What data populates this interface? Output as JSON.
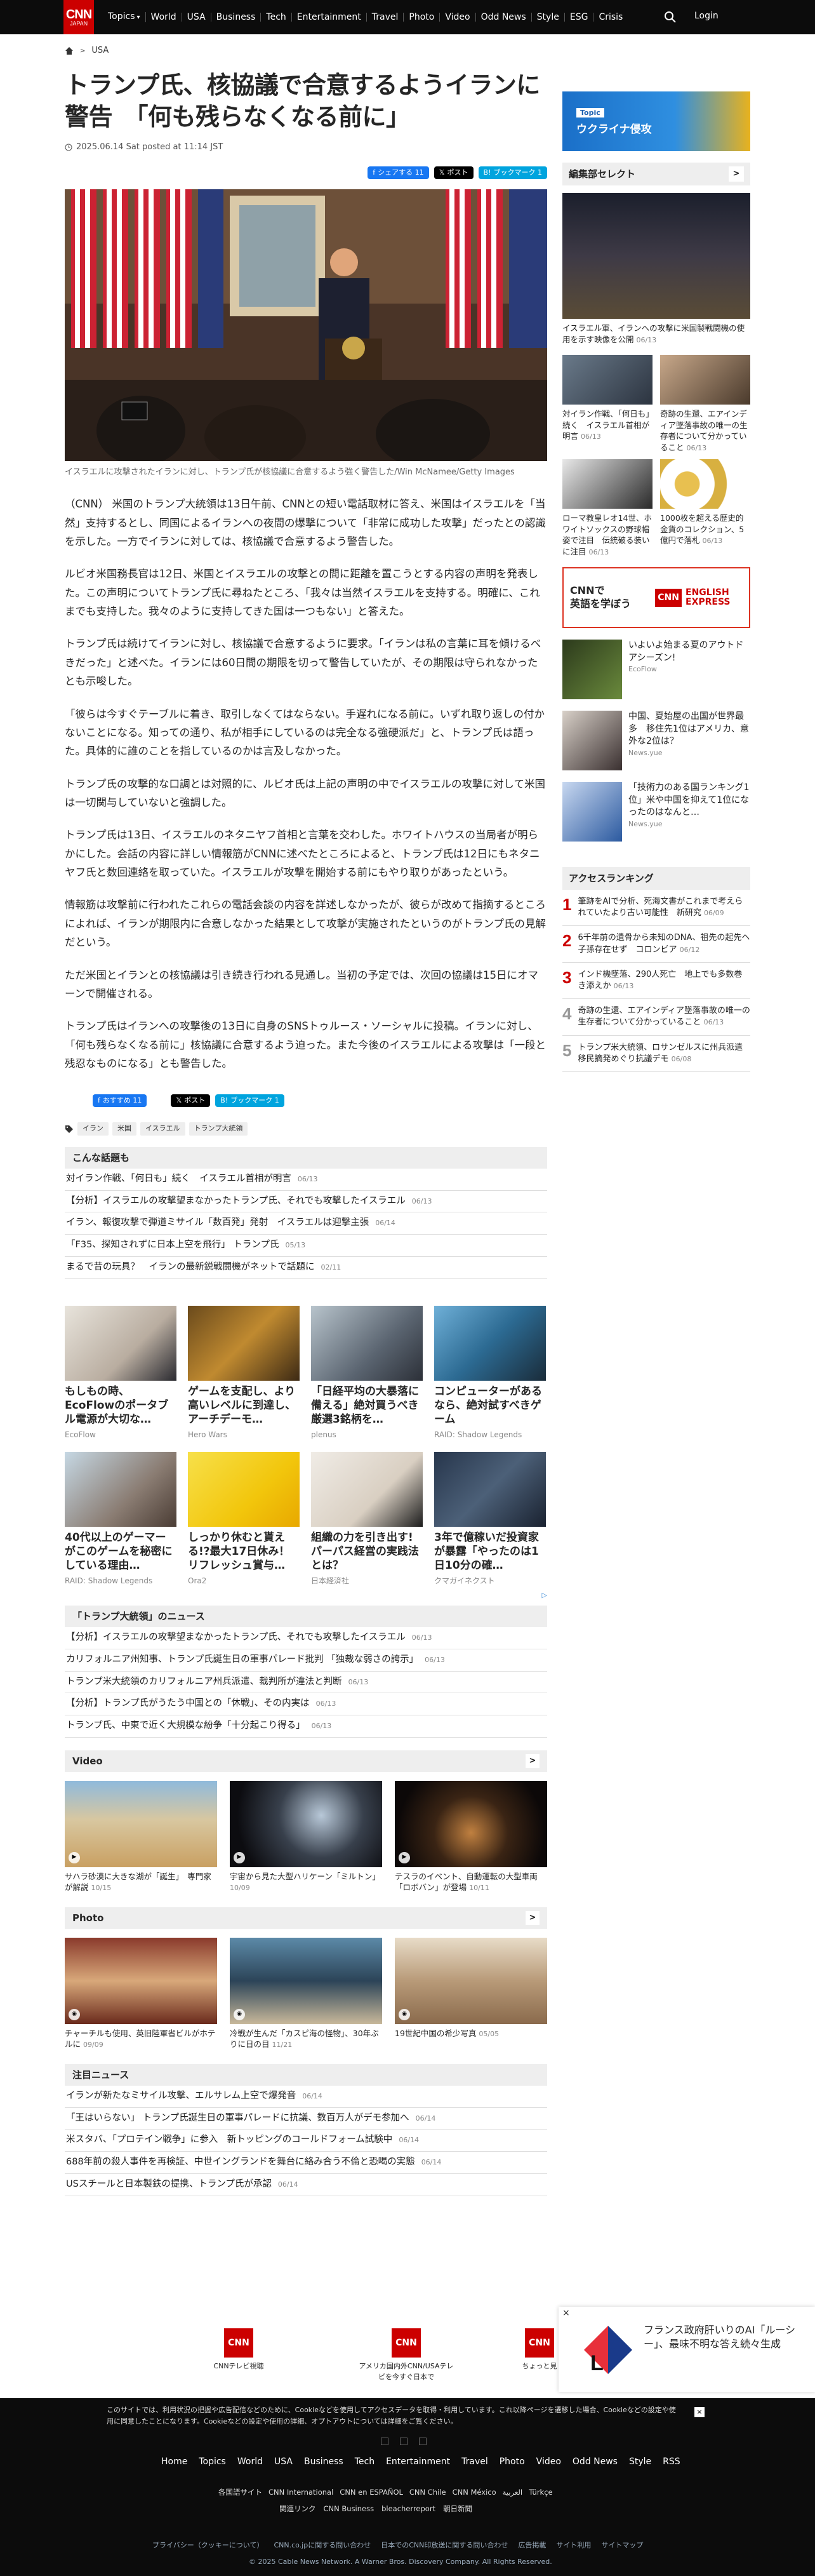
{
  "header": {
    "logo": "CNN",
    "logo_sub": "JAPAN",
    "nav": [
      "Topics",
      "World",
      "USA",
      "Business",
      "Tech",
      "Entertainment",
      "Travel",
      "Photo",
      "Video",
      "Odd News",
      "Style",
      "ESG",
      "Crisis"
    ],
    "login": "Login"
  },
  "breadcrumb": {
    "section": "USA"
  },
  "article": {
    "title": "トランプ氏、核協議で合意するようイランに警告　「何も残らなくなる前に」",
    "date": "2025.06.14 Sat posted at 11:14 JST",
    "share": {
      "fb": "シェアする 11",
      "x": "ポスト",
      "hb": "ブックマーク 1"
    },
    "caption": "イスラエルに攻撃されたイランに対し、トランプ氏が核協議に合意するよう強く警告した/Win McNamee/Getty Images",
    "paragraphs": [
      "（CNN） 米国のトランプ大統領は13日午前、CNNとの短い電話取材に答え、米国はイスラエルを「当然」支持するとし、同国によるイランへの夜間の爆撃について「非常に成功した攻撃」だったとの認識を示した。一方でイランに対しては、核協議で合意するよう警告した。",
      "ルビオ米国務長官は12日、米国とイスラエルの攻撃との間に距離を置こうとする内容の声明を発表した。この声明についてトランプ氏に尋ねたところ、「我々は当然イスラエルを支持する。明確に、これまでも支持した。我々のように支持してきた国は一つもない」と答えた。",
      "トランプ氏は続けてイランに対し、核協議で合意するように要求。「イランは私の言葉に耳を傾けるべきだった」と述べた。イランには60日間の期限を切って警告していたが、その期限は守られなかったとも示唆した。",
      "「彼らは今すぐテーブルに着き、取引しなくてはならない。手遅れになる前に。いずれ取り返しの付かないことになる。知っての通り、私が相手にしているのは完全なる強硬派だ」と、トランプ氏は語った。具体的に誰のことを指しているのかは言及しなかった。",
      "トランプ氏の攻撃的な口調とは対照的に、ルビオ氏は上記の声明の中でイスラエルの攻撃に対して米国は一切関与していないと強調した。",
      "トランプ氏は13日、イスラエルのネタニヤフ首相と言葉を交わした。ホワイトハウスの当局者が明らかにした。会話の内容に詳しい情報筋がCNNに述べたところによると、トランプ氏は12日にもネタニヤフ氏と数回連絡を取っていた。イスラエルが攻撃を開始する前にもやり取りがあったという。",
      "情報筋は攻撃前に行われたこれらの電話会談の内容を詳述しなかったが、彼らが改めて指摘するところによれば、イランが期限内に合意しなかった結果として攻撃が実施されたというのがトランプ氏の見解だという。",
      "ただ米国とイランとの核協議は引き続き行われる見通し。当初の予定では、次回の協議は15日にオマーンで開催される。",
      "トランプ氏はイランへの攻撃後の13日に自身のSNSトゥルース・ソーシャルに投稿。イランに対し、「何も残らなくなる前に」核協議に合意するよう迫った。また今後のイスラエルによる攻撃は「一段と残忍なものになる」とも警告した。"
    ],
    "share2": {
      "fb": "おすすめ 11",
      "x": "ポスト",
      "hb": "ブックマーク 1"
    },
    "tags": [
      "イラン",
      "米国",
      "イスラエル",
      "トランプ大統領"
    ]
  },
  "related": {
    "title": "こんな話題も",
    "items": [
      {
        "t": "対イラン作戦、「何日も」続く　イスラエル首相が明言",
        "d": "06/13"
      },
      {
        "t": "【分析】イスラエルの攻撃望まなかったトランプ氏、それでも攻撃したイスラエル",
        "d": "06/13"
      },
      {
        "t": "イラン、報復攻撃で弾道ミサイル「数百発」発射　イスラエルは迎撃主張",
        "d": "06/14"
      },
      {
        "t": "「F35、探知されずに日本上空を飛行」 トランプ氏",
        "d": "05/13"
      },
      {
        "t": "まるで昔の玩具？　イランの最新鋭戦闘機がネットで話題に",
        "d": "02/11"
      }
    ]
  },
  "ads": [
    {
      "h": "もしもの時、EcoFlowのポータブル電源が大切な…",
      "s": "EcoFlow"
    },
    {
      "h": "ゲームを支配し、より高いレベルに到達し、アーチデーモ…",
      "s": "Hero Wars"
    },
    {
      "h": "「日経平均の大暴落に備える」絶対買うべき厳選3銘柄を…",
      "s": "plenus"
    },
    {
      "h": "コンピューターがあるなら、絶対試すべきゲーム",
      "s": "RAID: Shadow Legends"
    },
    {
      "h": "40代以上のゲーマーがこのゲームを秘密にしている理由…",
      "s": "RAID: Shadow Legends"
    },
    {
      "h": "しっかり休むと貰える!?最大17日休み！リフレッシュ賞与…",
      "s": "Ora2"
    },
    {
      "h": "組織の力を引き出す! パーパス経営の実践法とは？",
      "s": "日本経済社"
    },
    {
      "h": "3年で億稼いだ投資家が暴露「やったのは1日10分の確…",
      "s": "クマガイネクスト"
    }
  ],
  "adchoices": "▷",
  "trump": {
    "title": "「トランプ大統領」のニュース",
    "items": [
      {
        "t": "【分析】イスラエルの攻撃望まなかったトランプ氏、それでも攻撃したイスラエル",
        "d": "06/13"
      },
      {
        "t": "カリフォルニア州知事、トランプ氏誕生日の軍事パレード批判 「独裁な弱さの誇示」",
        "d": "06/13"
      },
      {
        "t": "トランプ米大統領のカリフォルニア州兵派遣、裁判所が違法と判断",
        "d": "06/13"
      },
      {
        "t": "【分析】トランプ氏がうたう中国との「休戦」、その内実は",
        "d": "06/13"
      },
      {
        "t": "トランプ氏、中東で近く大規模な紛争「十分起こり得る」",
        "d": "06/13"
      }
    ]
  },
  "video": {
    "title": "Video",
    "items": [
      {
        "c": "サハラ砂漠に大きな湖が「誕生」　専門家が解説",
        "d": "10/15"
      },
      {
        "c": "宇宙から見た大型ハリケーン「ミルトン」",
        "d": "10/09"
      },
      {
        "c": "テスラのイベント、自動運転の大型車両「ロボバン」が登場",
        "d": "10/11"
      }
    ]
  },
  "photo": {
    "title": "Photo",
    "items": [
      {
        "c": "チャーチルも使用、英旧陸軍省ビルがホテルに",
        "d": "09/09"
      },
      {
        "c": "冷戦が生んだ「カスピ海の怪物」、30年ぶりに日の目",
        "d": "11/21"
      },
      {
        "c": "19世紀中国の希少写真",
        "d": "05/05"
      }
    ]
  },
  "notice": {
    "title": "注目ニュース",
    "items": [
      {
        "t": "イランが新たなミサイル攻撃、エルサレム上空で爆発音",
        "d": "06/14"
      },
      {
        "t": "「王はいらない」 トランプ氏誕生日の軍事パレードに抗議、数百万人がデモ参加へ",
        "d": "06/14"
      },
      {
        "t": "米スタバ、「プロテイン戦争」に参入　新トッピングのコールドフォーム試験中",
        "d": "06/14"
      },
      {
        "t": "688年前の殺人事件を再検証、中世イングランドを舞台に絡み合う不倫と恐喝の実態",
        "d": "06/14"
      },
      {
        "t": "USスチールと日本製鉄の提携、トランプ氏が承認",
        "d": "06/14"
      }
    ]
  },
  "apps": {
    "a1": "CNNテレビ視聴",
    "a2": "アメリカ国内外CNN/USAテレビを今すぐ日本で",
    "a3": "ちょっと見"
  },
  "floatad": {
    "text": "フランス政府肝いりのAI「ルーシー」、最味不明な答え続々生成",
    "close": "×"
  },
  "sidebar": {
    "promo": {
      "tag": "Topic",
      "text": "ウクライナ侵攻"
    },
    "editor": {
      "title": "編集部セレクト",
      "main": {
        "c": "イスラエル軍、イランへの攻撃に米国製戦闘機の使用を示す映像を公開",
        "d": "06/13"
      },
      "items": [
        {
          "c": "対イラン作戦、「何日も」続く　イスラエル首相が明言",
          "d": "06/13"
        },
        {
          "c": "奇跡の生還、エアインディア墜落事故の唯一の生存者について分かっていること",
          "d": "06/13"
        },
        {
          "c": "ローマ教皇レオ14世、ホワイトソックスの野球帽姿で注目　伝統破る装いに注目",
          "d": "06/13"
        },
        {
          "c": "1000枚を超える歴史的金貨のコレクション、5億円で落札",
          "d": "06/13"
        }
      ]
    },
    "cnnbanner": {
      "left1": "CNNで",
      "left2": "英語を学ぼう",
      "right1": "CNN",
      "right2": "ENGLISH EXPRESS"
    },
    "sponsored": [
      {
        "t": "いよいよ始まる夏のアウトドアシーズン!",
        "d": "EcoFlow"
      },
      {
        "t": "中国、夏始屋の出国が世界最多　移住先1位はアメリカ、意外な2位は？",
        "d": "News.yue"
      },
      {
        "t": "「技術力のある国ランキング1位」米や中国を抑えて1位になったのはなんと…",
        "d": "News.yue"
      }
    ],
    "ranking": {
      "title": "アクセスランキング",
      "items": [
        {
          "n": "1",
          "t": "筆跡をAIで分析、死海文書がこれまで考えられていたより古い可能性　新研究",
          "d": "06/09"
        },
        {
          "n": "2",
          "t": "6千年前の遺骨から未知のDNA、祖先の起先ヘ子孫存在せず　コロンビア",
          "d": "06/12"
        },
        {
          "n": "3",
          "t": "インド機墜落、290人死亡　地上でも多数巻き添えか",
          "d": "06/13"
        },
        {
          "n": "4",
          "t": "奇跡の生還、エアインディア墜落事故の唯一の生存者について分かっていること",
          "d": "06/13"
        },
        {
          "n": "5",
          "t": "トランプ米大統領、ロサンゼルスに州兵派遣　移民摘発めぐり抗議デモ",
          "d": "06/08"
        }
      ]
    }
  },
  "footer": {
    "cookie": "このサイトでは、利用状況の把握や広告配信などのために、Cookieなどを使用してアクセスデータを取得・利用しています。これ以降ページを遷移した場合、Cookieなどの設定や使用に同意したことになります。Cookieなどの設定や使用の詳細、オプトアウトについては詳細をご覧ください。",
    "close": "×",
    "nav": [
      "Home",
      "Topics",
      "World",
      "USA",
      "Business",
      "Tech",
      "Entertainment",
      "Travel",
      "Photo",
      "Video",
      "Odd News",
      "Style",
      "RSS"
    ],
    "nav2": [
      "各国語サイト",
      "CNN International",
      "CNN en ESPAÑOL",
      "CNN Chile",
      "CNN México",
      "العربية",
      "Türkçe"
    ],
    "nav3": [
      "関連リンク",
      "CNN Business",
      "bleacherreport",
      "朝日新聞"
    ],
    "nav4": [
      "プライバシー（クッキーについて）",
      "CNN.co.jpに関する問い合わせ",
      "日本でのCNN印放送に関する問い合わせ",
      "広告掲載",
      "サイト利用",
      "サイトマップ"
    ],
    "copy": "© 2025 Cable News Network. A Warner Bros. Discovery Company. All Rights Reserved."
  }
}
